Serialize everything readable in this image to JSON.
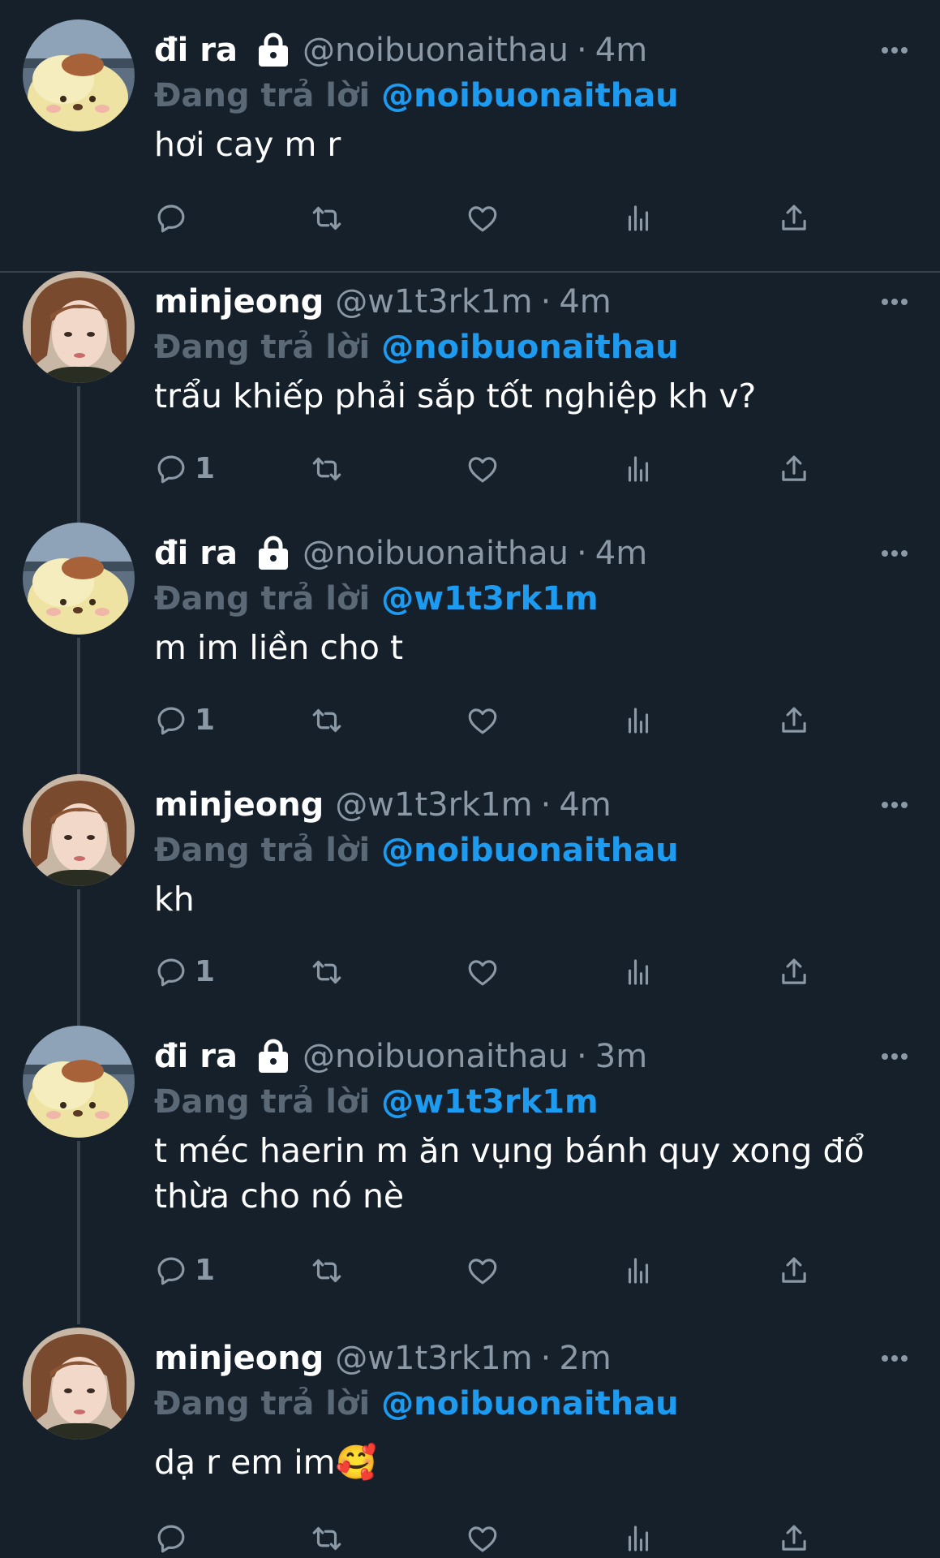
{
  "reply_prefix": "Đang trả lời",
  "tweets": [
    {
      "name": "đi ra",
      "protected": true,
      "handle": "@noibuonaithau",
      "separator": "·",
      "time": "4m",
      "reply_to": "@noibuonaithau",
      "text": "hơi cay m r",
      "reply_count": ""
    },
    {
      "name": "minjeong",
      "protected": false,
      "handle": "@w1t3rk1m",
      "separator": "·",
      "time": "4m",
      "reply_to": "@noibuonaithau",
      "text": "trẩu khiếp phải sắp tốt nghiệp kh v?",
      "reply_count": "1"
    },
    {
      "name": "đi ra",
      "protected": true,
      "handle": "@noibuonaithau",
      "separator": "·",
      "time": "4m",
      "reply_to": "@w1t3rk1m",
      "text": "m im liền cho t",
      "reply_count": "1"
    },
    {
      "name": "minjeong",
      "protected": false,
      "handle": "@w1t3rk1m",
      "separator": "·",
      "time": "4m",
      "reply_to": "@noibuonaithau",
      "text": "kh",
      "reply_count": "1"
    },
    {
      "name": "đi ra",
      "protected": true,
      "handle": "@noibuonaithau",
      "separator": "·",
      "time": "3m",
      "reply_to": "@w1t3rk1m",
      "text": "t méc haerin m ăn vụng bánh quy xong đổ thừa cho nó nè",
      "reply_count": "1"
    },
    {
      "name": "minjeong",
      "protected": false,
      "handle": "@w1t3rk1m",
      "separator": "·",
      "time": "2m",
      "reply_to": "@noibuonaithau",
      "text": "dạ r em im🥰",
      "reply_count": ""
    }
  ],
  "colors": {
    "background": "#15202b",
    "text": "#ffffff",
    "secondary": "#8b98a5",
    "mention": "#1d9bf0",
    "divider": "#38444d"
  },
  "icons": [
    "lock-icon",
    "more-icon",
    "reply-icon",
    "retweet-icon",
    "like-icon",
    "views-icon",
    "share-icon"
  ]
}
